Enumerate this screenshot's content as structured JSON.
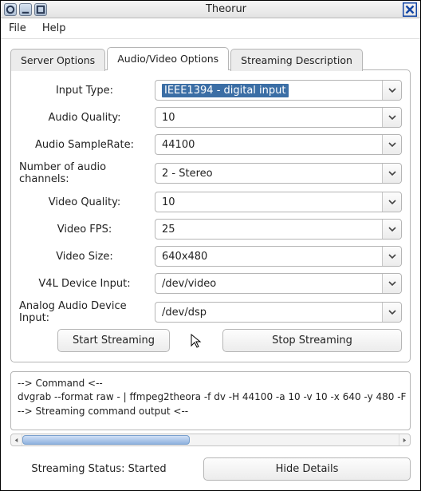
{
  "window": {
    "title": "Theorur"
  },
  "menu": {
    "file": "File",
    "help": "Help"
  },
  "tabs": {
    "server": "Server Options",
    "av": "Audio/Video Options",
    "desc": "Streaming Description"
  },
  "labels": {
    "input_type": "Input Type:",
    "audio_quality": "Audio Quality:",
    "audio_samplerate": "Audio SampleRate:",
    "audio_channels": "Number of audio channels:",
    "video_quality": "Video Quality:",
    "video_fps": "Video FPS:",
    "video_size": "Video Size:",
    "v4l_device": "V4L Device Input:",
    "analog_audio_device": "Analog Audio Device Input:"
  },
  "values": {
    "input_type": "IEEE1394 - digital input",
    "audio_quality": "10",
    "audio_samplerate": "44100",
    "audio_channels": "2 - Stereo",
    "video_quality": "10",
    "video_fps": "25",
    "video_size": "640x480",
    "v4l_device": "/dev/video",
    "analog_audio_device": "/dev/dsp"
  },
  "buttons": {
    "start": "Start Streaming",
    "stop": "Stop Streaming",
    "hide": "Hide Details"
  },
  "log": {
    "l1": "-->    Command    <--",
    "l2": "dvgrab --format raw - | ffmpeg2theora -f dv -H 44100 -a 10 -v 10 -x 640 -y 480 -F",
    "l3": "--> Streaming command output <--"
  },
  "status": {
    "label": "Streaming Status: Started"
  }
}
